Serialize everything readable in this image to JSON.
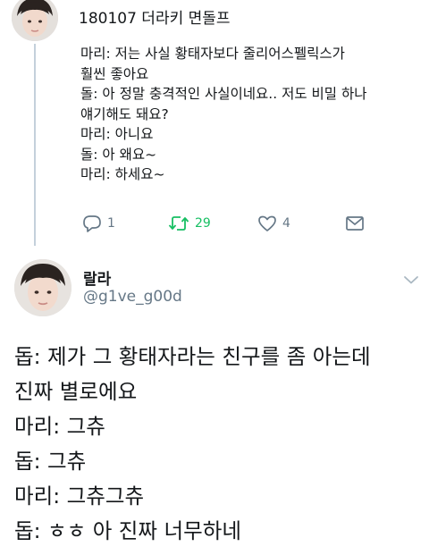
{
  "parent_tweet": {
    "header_partial": "180107 더라키 면돌프",
    "lines": [
      "마리: 저는 사실 황태자보다 줄리어스펠릭스가",
      "훨씬 좋아요",
      "돌: 아 정말 충격적인 사실이네요.. 저도 비밀 하나",
      "얘기해도 돼요?",
      "마리: 아니요",
      "돌: 아 왜요~",
      "마리: 하세요~"
    ],
    "actions": {
      "reply_count": "1",
      "retweet_count": "29",
      "like_count": "4"
    }
  },
  "reply_tweet": {
    "name": "랄라",
    "handle": "@g1ve_g00d",
    "lines": [
      "돕: 제가 그 황태자라는 친구를 좀 아는데",
      "진짜 별로에요",
      "마리: 그츄",
      "돕: 그츄",
      "마리: 그츄그츄",
      "돕: ㅎㅎ 아 진짜 너무하네"
    ]
  },
  "colors": {
    "text": "#14171a",
    "secondary": "#657786",
    "retweet": "#17bf63",
    "thread_line": "#c4d0db"
  }
}
